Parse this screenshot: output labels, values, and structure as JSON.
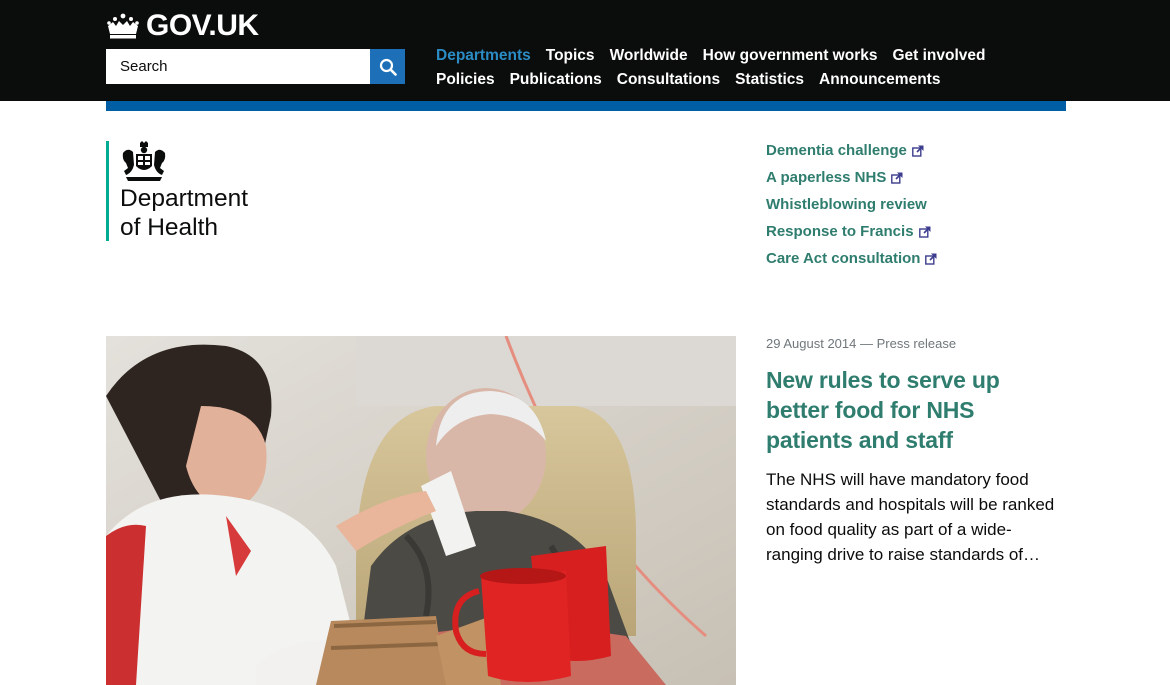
{
  "header": {
    "logo_text": "GOV.UK",
    "search_placeholder": "Search",
    "nav_row1": [
      "Departments",
      "Topics",
      "Worldwide",
      "How government works",
      "Get involved"
    ],
    "nav_row2": [
      "Policies",
      "Publications",
      "Consultations",
      "Statistics",
      "Announcements"
    ],
    "active_item": "Departments"
  },
  "organisation": {
    "name_line1": "Department",
    "name_line2": "of Health"
  },
  "featured_links": [
    {
      "label": "Dementia challenge"
    },
    {
      "label": "A paperless NHS"
    },
    {
      "label": "Whistleblowing review"
    },
    {
      "label": "Response to Francis"
    },
    {
      "label": "Care Act consultation"
    }
  ],
  "story": {
    "meta": "29 August 2014 — Press release",
    "title": "New rules to serve up better food for NHS patients and staff",
    "summary": "The NHS will have mandatory food standards and hospitals will be ranked on food quality as part of a wide-ranging drive to raise standards of…"
  },
  "colors": {
    "header_bg": "#0b0c0c",
    "header_rule": "#005ea5",
    "active_nav": "#2b8cc4",
    "org_accent": "#00ad93",
    "link_green": "#2f7d6e",
    "search_button": "#1d70b8"
  },
  "icons": {
    "logo": "crown-icon",
    "search": "search-icon",
    "org": "coat-of-arms-icon",
    "external": "external-link-icon"
  }
}
